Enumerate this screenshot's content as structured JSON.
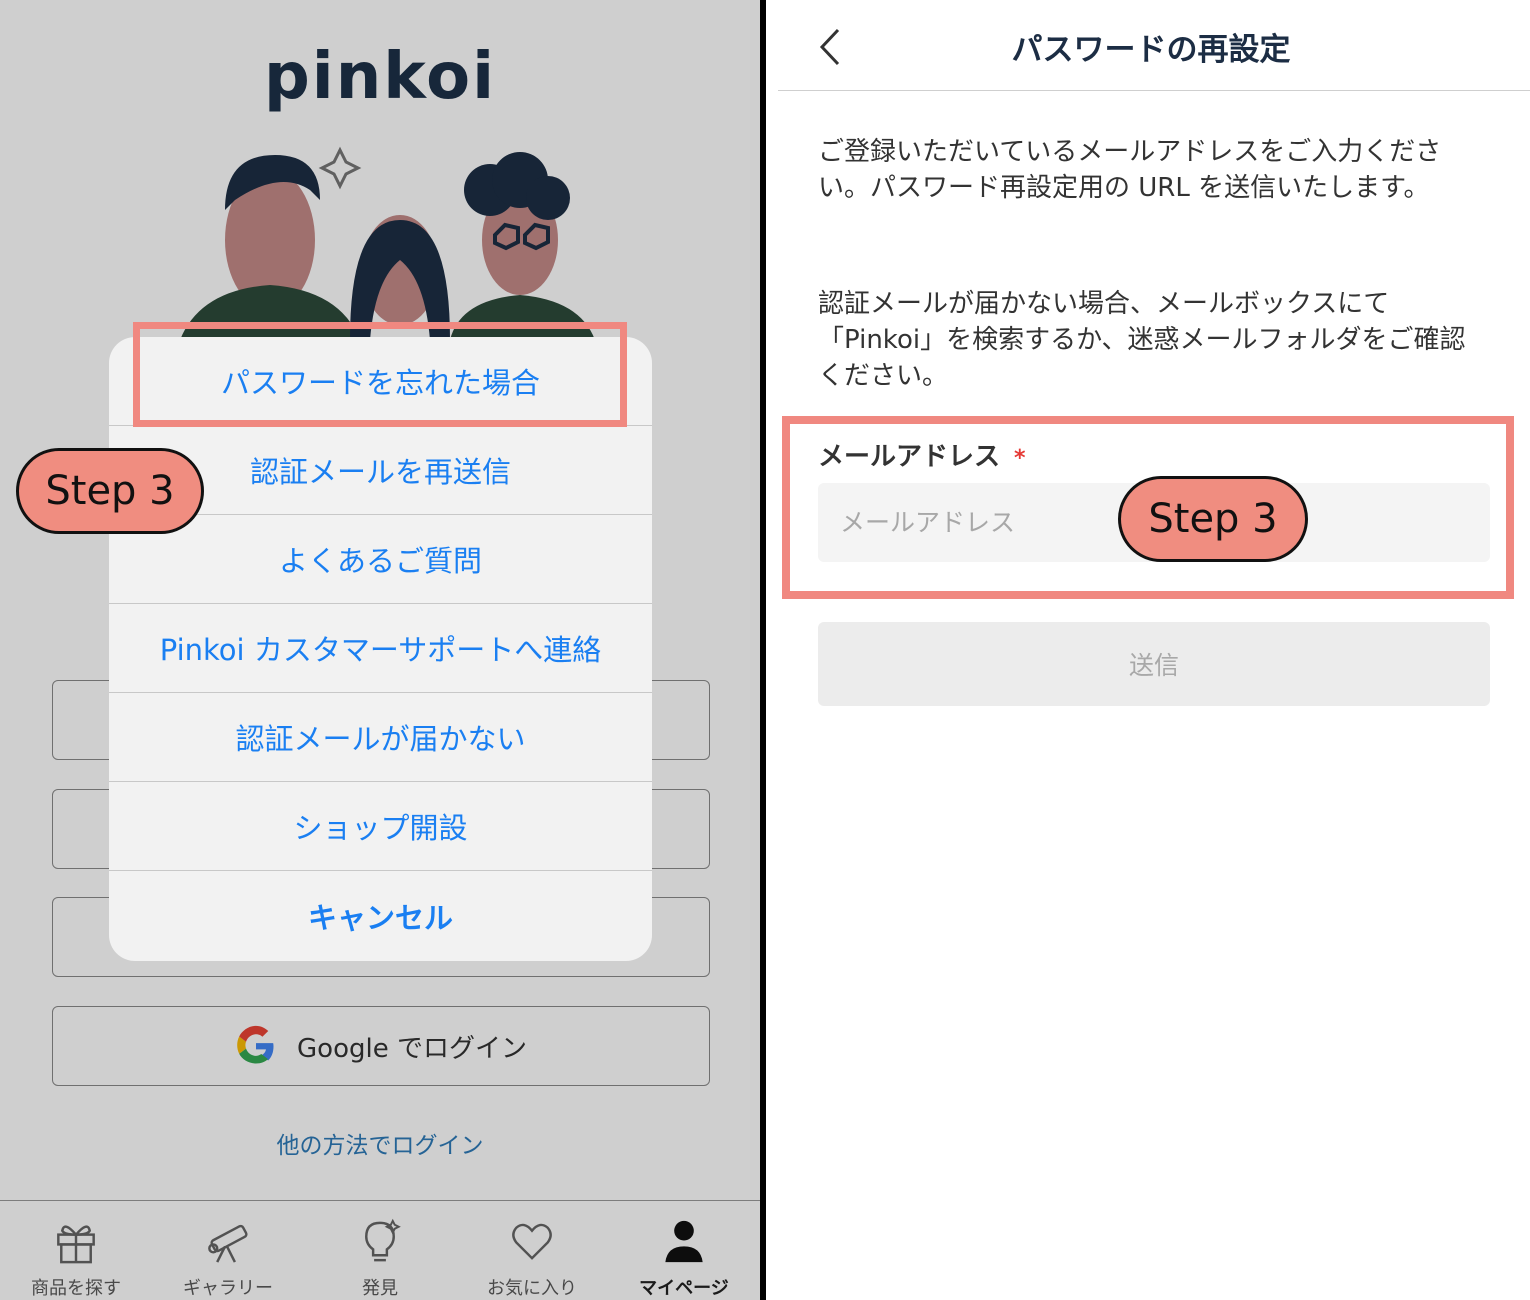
{
  "left": {
    "logo_text": "pinkoi",
    "action_sheet": [
      {
        "label": "パスワードを忘れた場合"
      },
      {
        "label": "認証メールを再送信"
      },
      {
        "label": "よくあるご質問"
      },
      {
        "label": "Pinkoi カスタマーサポートへ連絡"
      },
      {
        "label": "認証メールが届かない"
      },
      {
        "label": "ショップ開設"
      },
      {
        "label": "キャンセル"
      }
    ],
    "google_login_label": "Google でログイン",
    "other_login_label": "他の方法でログイン",
    "tabs": [
      {
        "label": "商品を探す",
        "icon": "gift-icon"
      },
      {
        "label": "ギャラリー",
        "icon": "telescope-icon"
      },
      {
        "label": "発見",
        "icon": "lightbulb-icon"
      },
      {
        "label": "お気に入り",
        "icon": "heart-icon"
      },
      {
        "label": "マイページ",
        "icon": "person-icon"
      }
    ],
    "step_badge": "Step 3"
  },
  "right": {
    "title": "パスワードの再設定",
    "paragraph1": "ご登録いただいているメールアドレスをご入力ください。パスワード再設定用の URL を送信いたします。",
    "paragraph2": "認証メールが届かない場合、メールボックスにて「Pinkoi」を検索するか、迷惑メールフォルダをご確認ください。",
    "email_label": "メールアドレス",
    "required_mark": "*",
    "email_placeholder": "メールアドレス",
    "email_value": "",
    "submit_label": "送信",
    "step_badge": "Step 3"
  },
  "colors": {
    "highlight": "#f08880",
    "badge_fill": "#f08d80",
    "link_blue": "#1a7ff2",
    "title_navy": "#1c2d44"
  }
}
